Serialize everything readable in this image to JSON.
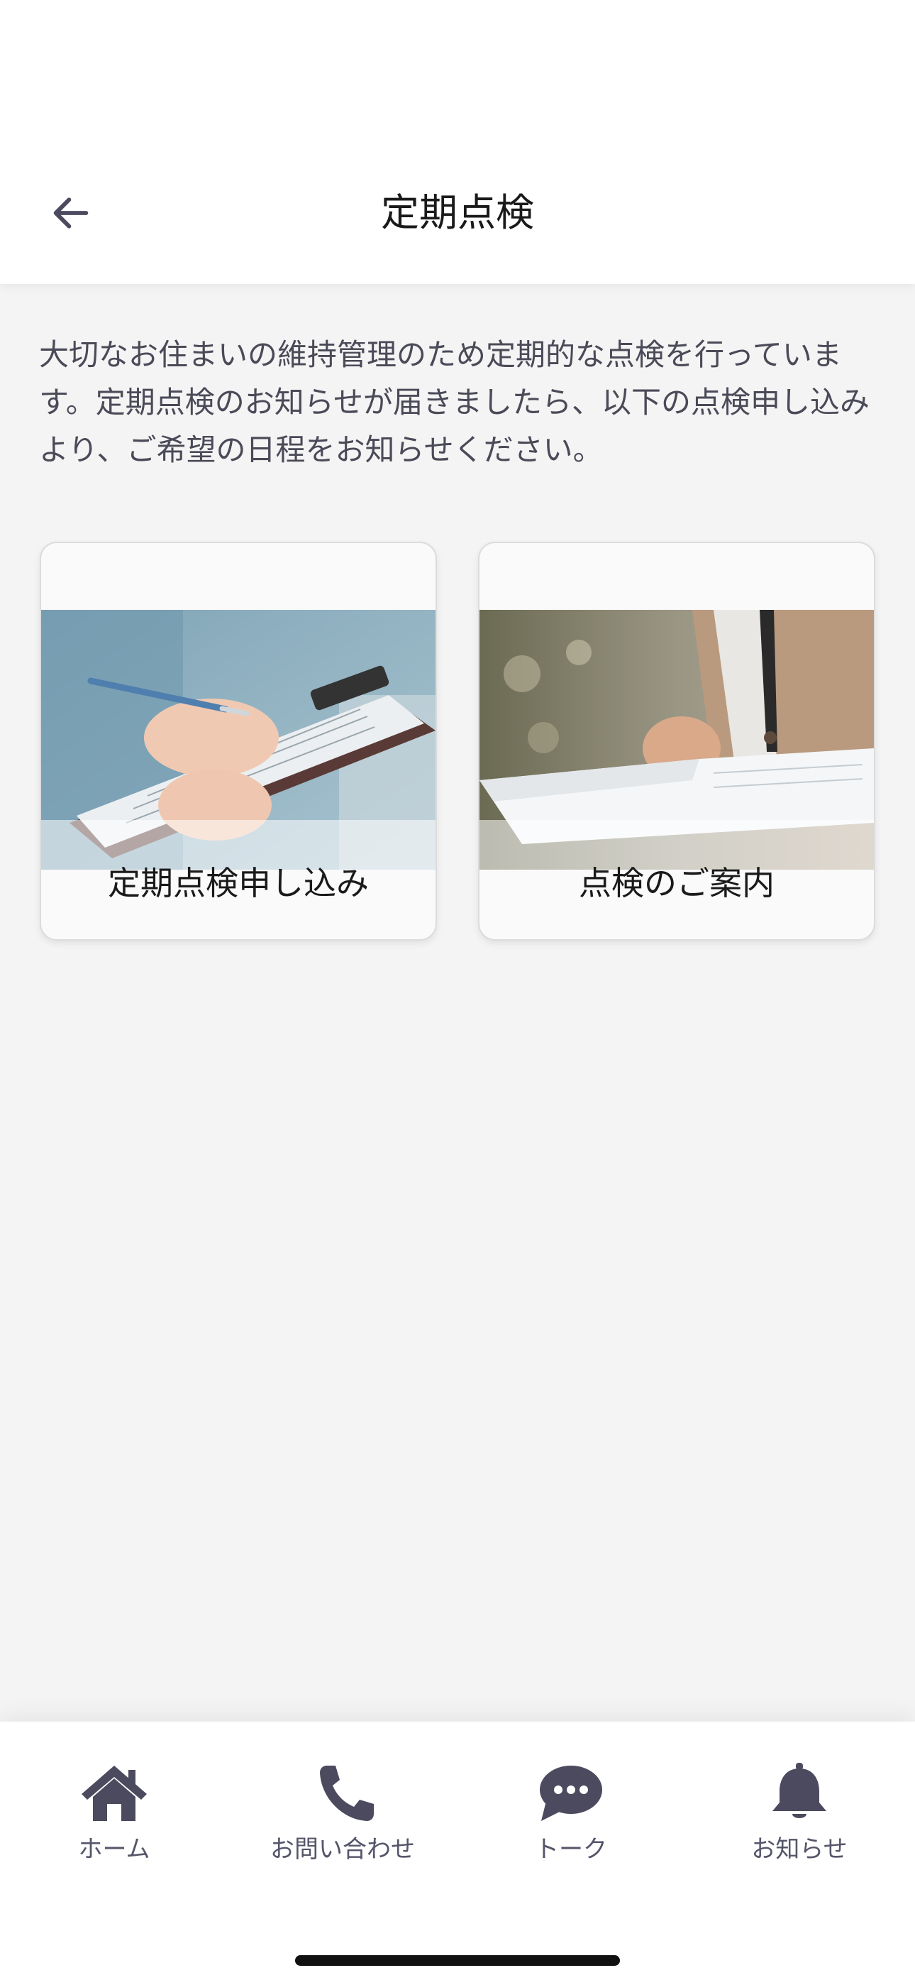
{
  "header": {
    "title": "定期点検",
    "back_icon": "arrow-left-icon"
  },
  "description": "大切なお住まいの維持管理のため定期的な点検を行っています。定期点検のお知らせが届きましたら、以下の点検申し込みより、ご希望の日程をお知らせください。",
  "cards": [
    {
      "label": "定期点検申し込み",
      "image": "clipboard-writing-photo"
    },
    {
      "label": "点検のご案内",
      "image": "document-reading-photo"
    }
  ],
  "tabbar": {
    "items": [
      {
        "label": "ホーム",
        "icon": "home-icon"
      },
      {
        "label": "お問い合わせ",
        "icon": "phone-icon"
      },
      {
        "label": "トーク",
        "icon": "chat-bubble-icon"
      },
      {
        "label": "お知らせ",
        "icon": "bell-icon"
      }
    ],
    "icon_color": "#4b4a5e"
  },
  "colors": {
    "background": "#f4f4f4",
    "header_bg": "#ffffff",
    "text_secondary": "#4a4a58"
  }
}
